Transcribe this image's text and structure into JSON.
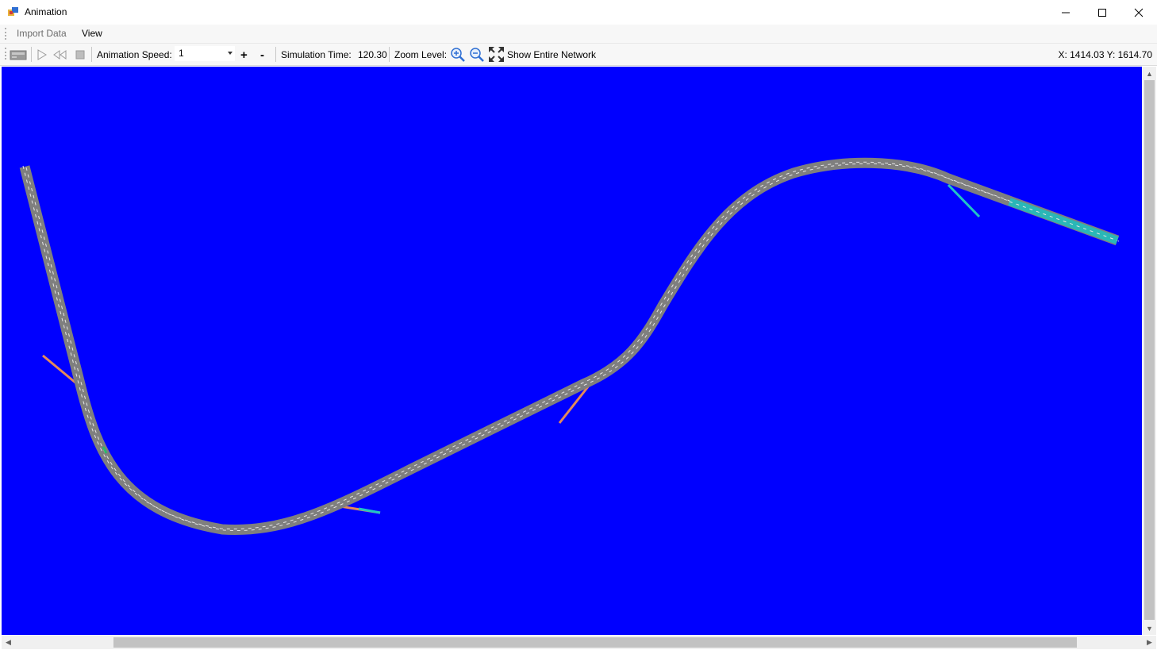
{
  "window": {
    "title": "Animation"
  },
  "menu": {
    "import_data": "Import Data",
    "view": "View"
  },
  "toolbar": {
    "animation_speed_label": "Animation Speed:",
    "animation_speed_value": "1",
    "plus_label": "+",
    "minus_label": "-",
    "simulation_time_label": "Simulation Time:",
    "simulation_time_value": "120.30",
    "zoom_level_label": "Zoom Level:",
    "show_entire_network_label": "Show Entire Network",
    "coordinates": "X: 1414.03 Y: 1614.70"
  },
  "colors": {
    "canvas_background": "#0000ff",
    "road": "#808080",
    "lane_marking": "#e6e6e6",
    "ramp_orange": "#e38a5a",
    "ramp_cyan": "#22c4c4",
    "congestion_cyan": "#2ab7b7"
  }
}
